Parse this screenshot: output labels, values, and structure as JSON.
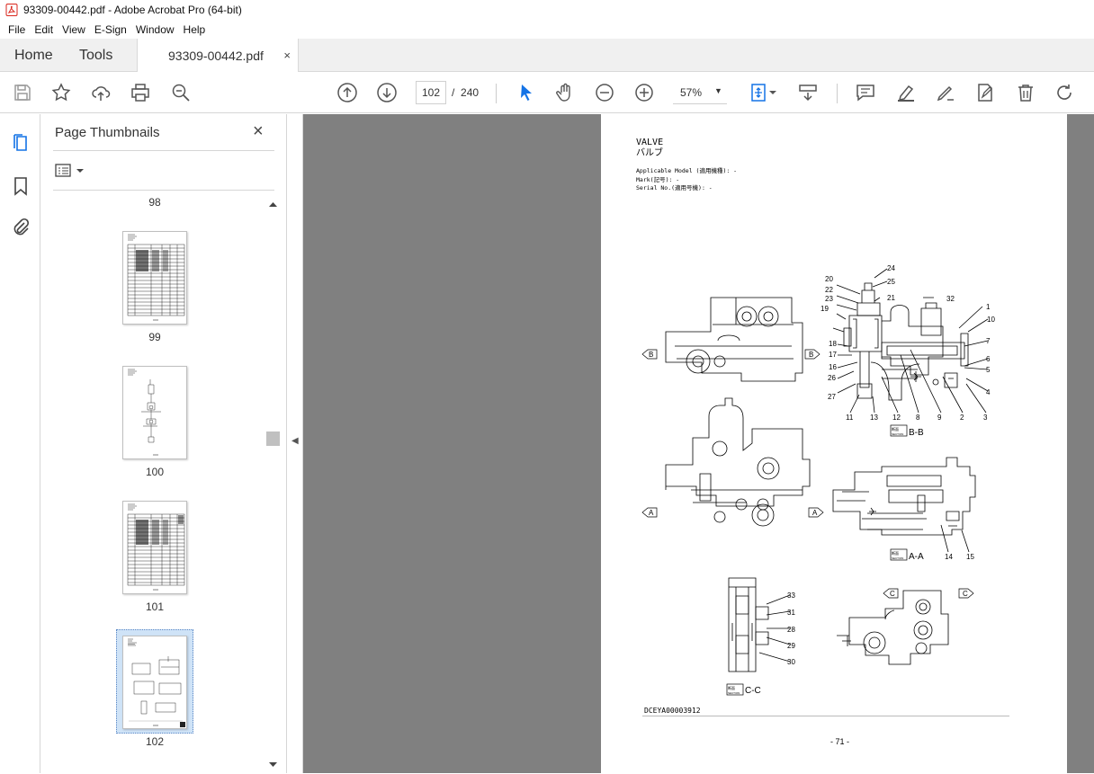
{
  "window": {
    "title": "93309-00442.pdf - Adobe Acrobat Pro (64-bit)"
  },
  "menu": [
    "File",
    "Edit",
    "View",
    "E-Sign",
    "Window",
    "Help"
  ],
  "tabs": {
    "home": "Home",
    "tools": "Tools",
    "document": "93309-00442.pdf",
    "close": "×"
  },
  "toolbar": {
    "current_page": "102",
    "page_separator": "/",
    "total_pages": "240",
    "zoom": "57%"
  },
  "thumbnails": {
    "title": "Page Thumbnails",
    "close": "×",
    "pages": [
      {
        "label": "98"
      },
      {
        "label": "99"
      },
      {
        "label": "100"
      },
      {
        "label": "101"
      },
      {
        "label": "102",
        "selected": true
      }
    ]
  },
  "document": {
    "title_en": "VALVE",
    "title_jp": "バルブ",
    "meta": [
      "Applicable Model (適用機種): -",
      "Mark(記号): -",
      "Serial No.(適用号機): -"
    ],
    "drawing_code": "DCEYA00003912",
    "page_number": "- 71 -",
    "section_labels": {
      "bb": "B-B",
      "aa": "A-A",
      "cc": "C-C",
      "jp_small": "断面",
      "section_word": "SECTION"
    },
    "callouts": {
      "left_top": [
        "20",
        "22",
        "23",
        "19",
        "18",
        "17",
        "16",
        "26",
        "27"
      ],
      "top": [
        "24",
        "25",
        "21",
        "32"
      ],
      "right": [
        "1",
        "10",
        "7",
        "6",
        "5",
        "4"
      ],
      "bottom": [
        "11",
        "13",
        "12",
        "8",
        "9",
        "2",
        "3"
      ],
      "aa_bottom": [
        "14",
        "15"
      ],
      "cc": [
        "33",
        "31",
        "28",
        "29",
        "30"
      ]
    },
    "view_markers": {
      "a": "A",
      "b": "B",
      "c": "C"
    }
  },
  "colors": {
    "accent_blue": "#1473e6",
    "canvas_gray": "#808080",
    "selection_blue": "#cfe3f7",
    "acrobat_red": "#d9261c"
  }
}
